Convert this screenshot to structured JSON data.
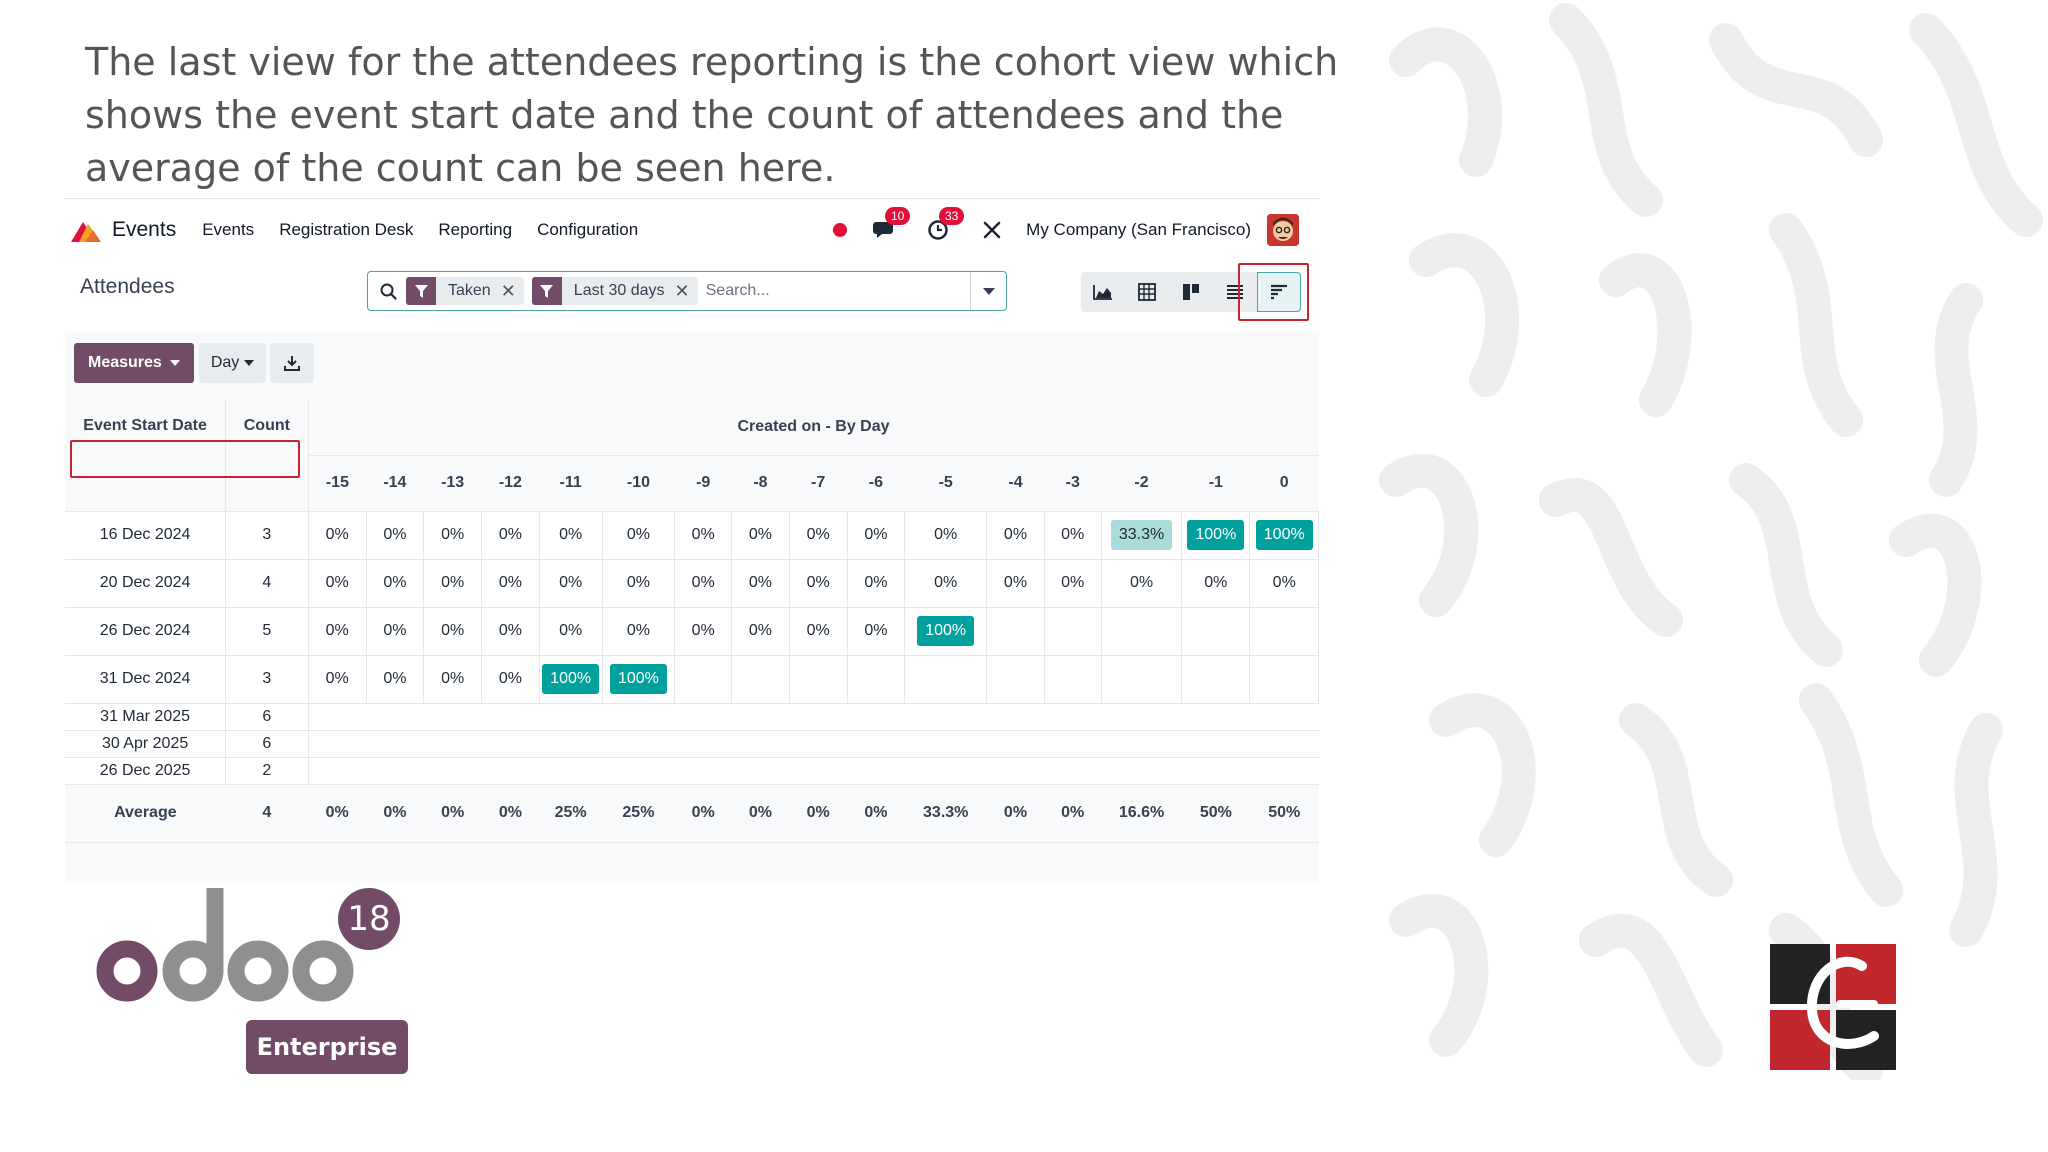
{
  "caption": {
    "line1": "The last view for the attendees reporting is the cohort view which",
    "line2": "shows the event start date and the count of attendees  and the",
    "line3": "average of the count can be seen here."
  },
  "navbar": {
    "app_name": "Events",
    "menu": [
      "Events",
      "Registration Desk",
      "Reporting",
      "Configuration"
    ],
    "messages_count": "10",
    "activities_count": "33",
    "company": "My Company (San Francisco)"
  },
  "control_panel": {
    "title": "Attendees",
    "facets": [
      "Taken",
      "Last 30 days"
    ],
    "search_placeholder": "Search...",
    "views": [
      "graph-view-icon",
      "pivot-view-icon",
      "kanban-view-icon",
      "list-view-icon",
      "cohort-view-icon"
    ],
    "active_view": "cohort"
  },
  "toolbar": {
    "measures_label": "Measures",
    "interval_label": "Day"
  },
  "cohort": {
    "group_title": "Created on - By Day",
    "row_header": "Event Start Date",
    "count_header": "Count",
    "columns": [
      "-15",
      "-14",
      "-13",
      "-12",
      "-11",
      "-10",
      "-9",
      "-8",
      "-7",
      "-6",
      "-5",
      "-4",
      "-3",
      "-2",
      "-1",
      "0"
    ],
    "rows": [
      {
        "date": "16 Dec 2024",
        "count": "3",
        "values": [
          "0%",
          "0%",
          "0%",
          "0%",
          "0%",
          "0%",
          "0%",
          "0%",
          "0%",
          "0%",
          "0%",
          "0%",
          "0%",
          "33.3%",
          "100%",
          "100%"
        ]
      },
      {
        "date": "20 Dec 2024",
        "count": "4",
        "values": [
          "0%",
          "0%",
          "0%",
          "0%",
          "0%",
          "0%",
          "0%",
          "0%",
          "0%",
          "0%",
          "0%",
          "0%",
          "0%",
          "0%",
          "0%",
          "0%"
        ]
      },
      {
        "date": "26 Dec 2024",
        "count": "5",
        "values": [
          "0%",
          "0%",
          "0%",
          "0%",
          "0%",
          "0%",
          "0%",
          "0%",
          "0%",
          "0%",
          "100%",
          "",
          "",
          "",
          "",
          ""
        ]
      },
      {
        "date": "31 Dec 2024",
        "count": "3",
        "values": [
          "0%",
          "0%",
          "0%",
          "0%",
          "100%",
          "100%",
          "",
          "",
          "",
          "",
          "",
          "",
          "",
          "",
          "",
          ""
        ]
      },
      {
        "date": "31 Mar 2025",
        "count": "6",
        "values": []
      },
      {
        "date": "30 Apr 2025",
        "count": "6",
        "values": []
      },
      {
        "date": "26 Dec 2025",
        "count": "2",
        "values": []
      }
    ],
    "average": {
      "label": "Average",
      "count": "4",
      "values": [
        "0%",
        "0%",
        "0%",
        "0%",
        "25%",
        "25%",
        "0%",
        "0%",
        "0%",
        "0%",
        "33.3%",
        "0%",
        "0%",
        "16.6%",
        "50%",
        "50%"
      ]
    }
  },
  "branding": {
    "version": "18",
    "edition": "Enterprise",
    "logo_text": "odoo"
  },
  "colors": {
    "primary": "#714b67",
    "teal": "#00a09d",
    "teal_light": "#a8dbd9",
    "highlight_red": "#c1272d",
    "badge_red": "#e0103a"
  }
}
